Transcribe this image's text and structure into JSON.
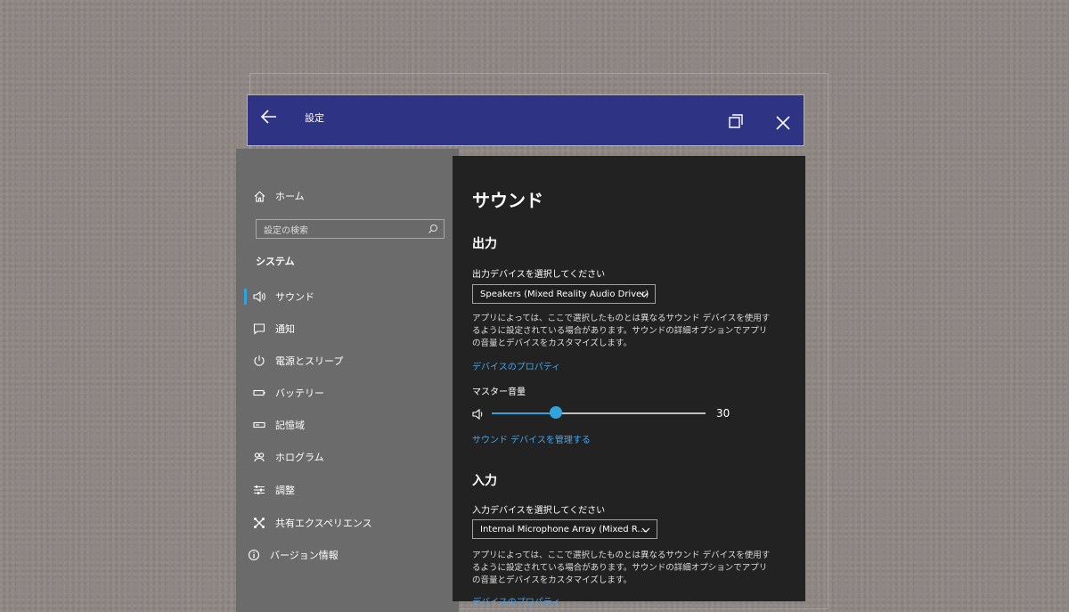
{
  "window": {
    "title": "設定"
  },
  "sidebar": {
    "home": "ホーム",
    "search_placeholder": "設定の検索",
    "section": "システム",
    "items": [
      {
        "label": "サウンド",
        "icon": "speaker-icon",
        "active": true
      },
      {
        "label": "通知",
        "icon": "notification-icon"
      },
      {
        "label": "電源とスリープ",
        "icon": "power-icon"
      },
      {
        "label": "バッテリー",
        "icon": "battery-icon"
      },
      {
        "label": "記憶域",
        "icon": "storage-icon"
      },
      {
        "label": "ホログラム",
        "icon": "hologram-icon"
      },
      {
        "label": "調整",
        "icon": "adjust-icon"
      },
      {
        "label": "共有エクスペリエンス",
        "icon": "shared-experience-icon"
      },
      {
        "label": "バージョン情報",
        "icon": "info-icon"
      }
    ]
  },
  "main": {
    "title": "サウンド",
    "output": {
      "heading": "出力",
      "select_label": "出力デバイスを選択してください",
      "device": "Speakers (Mixed Reality Audio Driver)",
      "description": "アプリによっては、ここで選択したものとは異なるサウンド デバイスを使用するように設定されている場合があります。サウンドの詳細オプションでアプリの音量とデバイスをカスタマイズします。",
      "properties_link": "デバイスのプロパティ",
      "volume_label": "マスター音量",
      "volume_value": "30",
      "volume_fraction": 0.3,
      "manage_link": "サウンド デバイスを管理する"
    },
    "input": {
      "heading": "入力",
      "select_label": "入力デバイスを選択してください",
      "device": "Internal Microphone Array (Mixed R...",
      "description": "アプリによっては、ここで選択したものとは異なるサウンド デバイスを使用するように設定されている場合があります。サウンドの詳細オプションでアプリの音量とデバイスをカスタマイズします。",
      "properties_link": "デバイスのプロパティ"
    }
  },
  "colors": {
    "titlebar": "#2e3384",
    "accent": "#33a3dc",
    "link": "#4aa5e8"
  }
}
